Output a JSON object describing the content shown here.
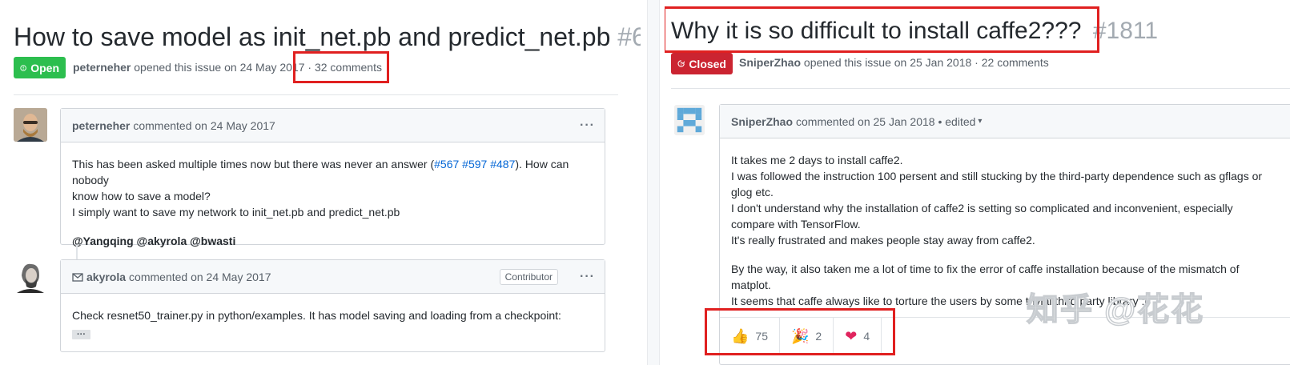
{
  "left": {
    "title": "How to save model as init_net.pb and predict_net.pb",
    "number": "#6",
    "state_label": "Open",
    "meta_author": "peterneher",
    "meta_text": "opened this issue on 24 May 2017 ·",
    "comment_count": "32 comments",
    "comment1": {
      "author": "peterneher",
      "action": "commented on 24 May 2017",
      "menu": "···",
      "line1_pre": "This has been asked multiple times now but there was never an answer (",
      "link1": "#567",
      "link2": "#597",
      "link3": "#487",
      "line1_post": "). How can nobody",
      "line2": "know how to save a model?",
      "line3": "I simply want to save my network to init_net.pb and predict_net.pb",
      "mentions": "@Yangqing @akyrola @bwasti"
    },
    "comment2": {
      "author": "akyrola",
      "action": "commented on 24 May 2017",
      "badge": "Contributor",
      "menu": "···",
      "text": "Check resnet50_trainer.py in python/examples. It has model saving and loading from a checkpoint:",
      "more": "···"
    }
  },
  "right": {
    "title": "Why it is so difficult to install caffe2???",
    "number": "#1811",
    "state_label": "Closed",
    "meta_author": "SniperZhao",
    "meta_text": "opened this issue on 25 Jan 2018 · 22 comments",
    "comment": {
      "author": "SniperZhao",
      "action": "commented on 25 Jan 2018 • edited",
      "caret": "▾",
      "menu": "···",
      "lines": [
        "It takes me 2 days to install caffe2.",
        "I was followed the instruction 100 persent and still stucking by the third-party dependence such as gflags or",
        "glog etc.",
        "I don't understand why the installation of caffe2 is setting so complicated and inconvenient, especially",
        "compare with TensorFlow.",
        "It's really frustrated and makes people stay away from caffe2."
      ],
      "lines2": [
        "By the way, it also taken me a lot of time to fix the error of caffe installation because of the mismatch of",
        "matplot.",
        "It seems that caffe always like to torture the users by some trivial third party library :("
      ]
    },
    "reactions": [
      {
        "emoji": "👍",
        "count": "75"
      },
      {
        "emoji": "🎉",
        "count": "2"
      },
      {
        "emoji": "❤",
        "count": "4"
      }
    ]
  },
  "watermark": "知乎 @花花",
  "colors": {
    "open": "#2cbe4e",
    "closed": "#cb2431",
    "highlight": "#e02020",
    "link": "#0366d6"
  }
}
